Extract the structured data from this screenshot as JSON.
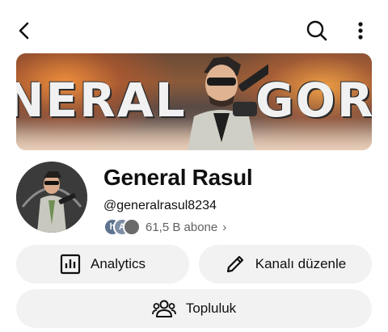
{
  "header": {
    "back_icon": "arrow-left-icon",
    "search_icon": "search-icon",
    "more_icon": "more-vertical-icon"
  },
  "banner": {
    "text_left": "NERAL",
    "text_right": "GORD"
  },
  "channel": {
    "name": "General Rasul",
    "handle": "@generalrasul8234",
    "subscriber_avatars": [
      "h",
      "A",
      ""
    ],
    "subscribers": "61,5 B abone",
    "subscribers_chevron": "›"
  },
  "actions": {
    "analytics_label": "Analytics",
    "edit_label": "Kanalı düzenle",
    "community_label": "Topluluk"
  },
  "colors": {
    "pill_bg": "#f2f2f2",
    "text_primary": "#0f0f0f",
    "text_secondary": "#606060"
  }
}
